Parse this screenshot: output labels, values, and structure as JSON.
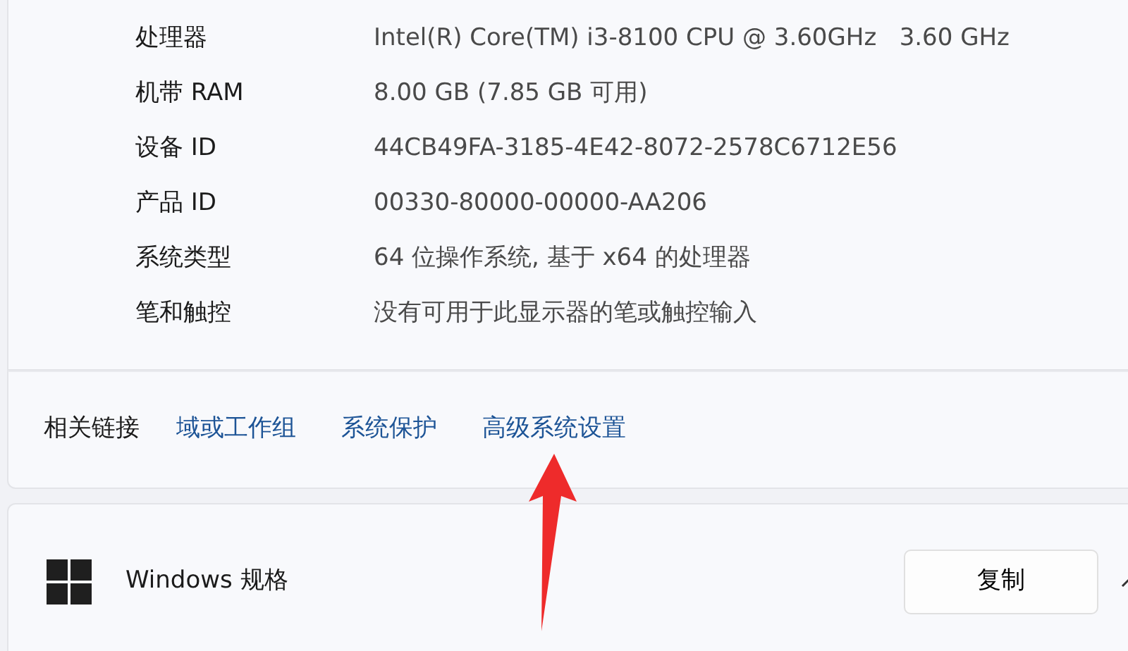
{
  "specs": [
    {
      "label": "处理器",
      "value": "Intel(R) Core(TM) i3-8100 CPU @ 3.60GHz   3.60 GHz"
    },
    {
      "label": "机带 RAM",
      "value": "8.00 GB (7.85 GB 可用)"
    },
    {
      "label": "设备 ID",
      "value": "44CB49FA-3185-4E42-8072-2578C6712E56"
    },
    {
      "label": "产品 ID",
      "value": "00330-80000-00000-AA206"
    },
    {
      "label": "系统类型",
      "value": "64 位操作系统, 基于 x64 的处理器"
    },
    {
      "label": "笔和触控",
      "value": "没有可用于此显示器的笔或触控输入"
    }
  ],
  "related_links": {
    "title": "相关链接",
    "links": [
      {
        "text": "域或工作组"
      },
      {
        "text": "系统保护"
      },
      {
        "text": "高级系统设置",
        "arrow_pointed": true
      }
    ]
  },
  "windows_spec": {
    "title": "Windows 规格",
    "copy_button": "复制",
    "expanded": true
  }
}
